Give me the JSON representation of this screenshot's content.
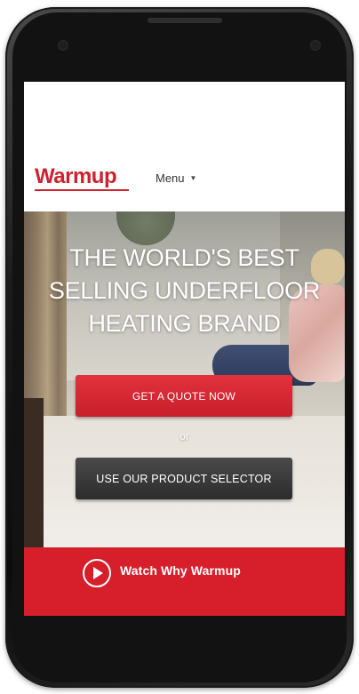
{
  "header": {
    "logo_text": "Warmup",
    "menu_label": "Menu",
    "menu_caret": "▼"
  },
  "hero": {
    "title_lines": [
      "THE WORLD'S BEST",
      "SELLING UNDERFLOOR",
      "HEATING BRAND"
    ],
    "primary_button": "GET A QUOTE NOW",
    "or_text": "or",
    "secondary_button": "USE OUR PRODUCT SELECTOR"
  },
  "video_bar": {
    "label": "Watch Why Warmup",
    "icon": "play-circle-icon"
  },
  "colors": {
    "brand_red": "#d71f2c",
    "button_dark": "#3a3a3a",
    "phone_body": "#111111"
  }
}
